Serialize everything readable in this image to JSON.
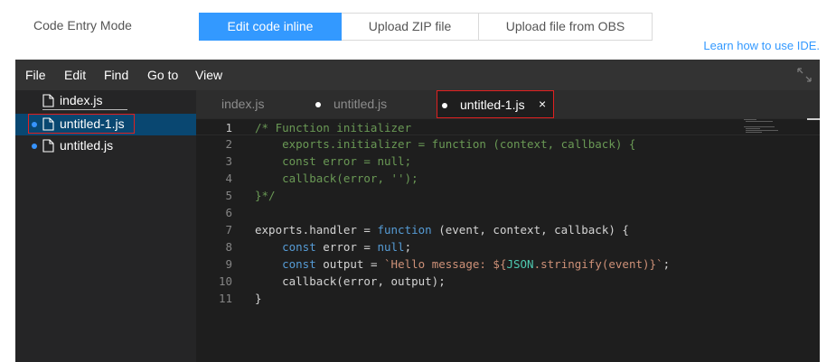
{
  "header": {
    "mode_label": "Code Entry Mode",
    "modes": [
      {
        "label": "Edit code inline",
        "active": true
      },
      {
        "label": "Upload ZIP file",
        "active": false
      },
      {
        "label": "Upload file from OBS",
        "active": false
      }
    ],
    "learn_link": "Learn how to use IDE."
  },
  "ide": {
    "menu": [
      "File",
      "Edit",
      "Find",
      "Go to",
      "View"
    ],
    "expand_icon": "expand-arrows-icon",
    "explorer": {
      "files": [
        {
          "name": "index.js",
          "modified": false,
          "selected": false
        },
        {
          "name": "untitled-1.js",
          "modified": true,
          "selected": true
        },
        {
          "name": "untitled.js",
          "modified": true,
          "selected": false
        }
      ],
      "file_icon": "file-icon"
    },
    "tabs": [
      {
        "name": "index.js",
        "modified": false,
        "active": false
      },
      {
        "name": "untitled.js",
        "modified": true,
        "active": false
      },
      {
        "name": "untitled-1.js",
        "modified": true,
        "active": true,
        "close": "×"
      }
    ],
    "editor": {
      "current_line": 1,
      "lines": [
        {
          "n": "1",
          "text": "/* Function initializer"
        },
        {
          "n": "2",
          "text": "    exports.initializer = function (context, callback) {"
        },
        {
          "n": "3",
          "text": "    const error = null;"
        },
        {
          "n": "4",
          "text": "    callback(error, '');"
        },
        {
          "n": "5",
          "text": "}*/"
        },
        {
          "n": "6",
          "text": ""
        },
        {
          "n": "7",
          "text": "exports.handler = function (event, context, callback) {"
        },
        {
          "n": "8",
          "text": "    const error = null;"
        },
        {
          "n": "9",
          "text": "    const output = `Hello message: ${JSON.stringify(event)}`;"
        },
        {
          "n": "10",
          "text": "    callback(error, output);"
        },
        {
          "n": "11",
          "text": "}"
        }
      ]
    }
  },
  "colors": {
    "accent": "#3399ff",
    "highlight_border": "#e02020",
    "comment": "#6a9955",
    "keyword": "#569cd6",
    "string": "#ce9178",
    "class": "#4ec9b0"
  }
}
